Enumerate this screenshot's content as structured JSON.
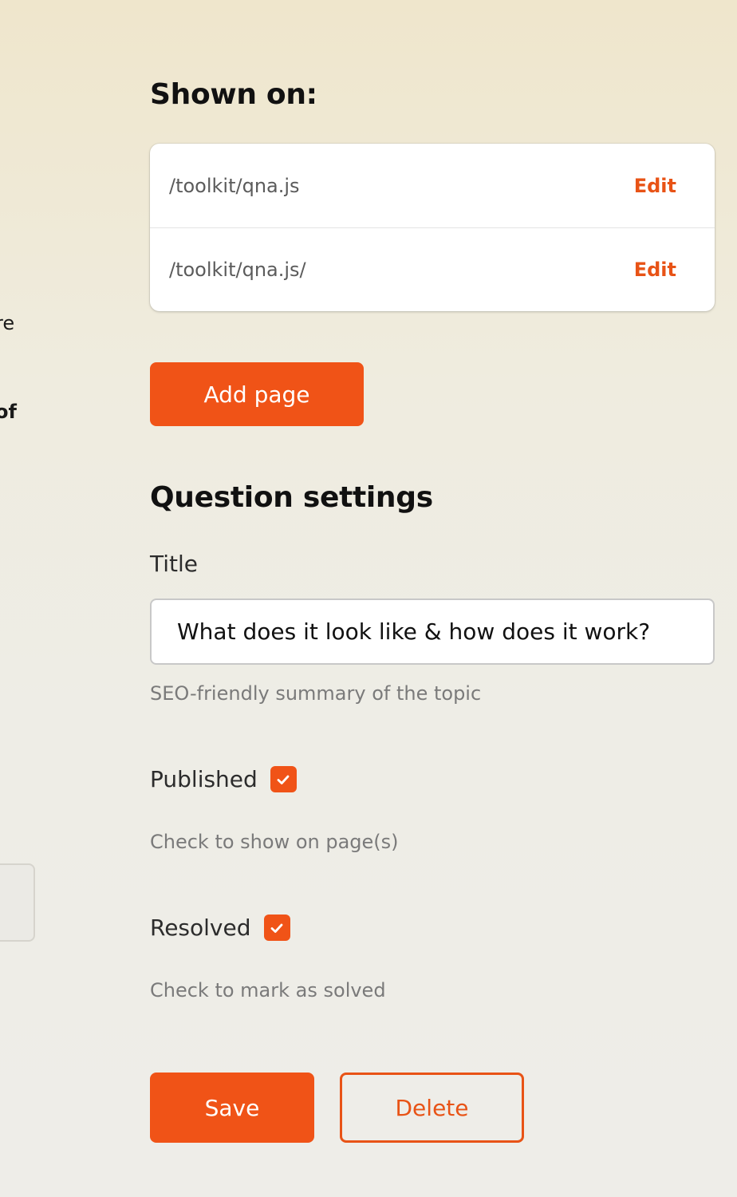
{
  "left_clipped": {
    "fragment_1": "re",
    "fragment_2": "of"
  },
  "shown_on": {
    "heading": "Shown on:",
    "pages": [
      {
        "path": "/toolkit/qna.js",
        "edit_label": "Edit"
      },
      {
        "path": "/toolkit/qna.js/",
        "edit_label": "Edit"
      }
    ],
    "add_page_label": "Add page"
  },
  "question_settings": {
    "heading": "Question settings",
    "title_label": "Title",
    "title_value": "What does it look like & how does it work?",
    "title_help": "SEO-friendly summary of the topic",
    "published_label": "Published",
    "published_checked": true,
    "published_help": "Check to show on page(s)",
    "resolved_label": "Resolved",
    "resolved_checked": true,
    "resolved_help": "Check to mark as solved"
  },
  "actions": {
    "save_label": "Save",
    "delete_label": "Delete"
  },
  "colors": {
    "accent": "#f05317",
    "link": "#e85316"
  }
}
